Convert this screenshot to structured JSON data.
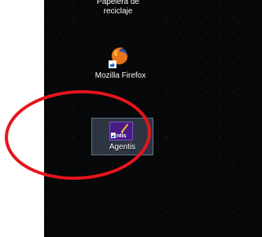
{
  "desktop": {
    "icons": [
      {
        "label_lines": [
          "Papelera de",
          "reciclaje"
        ],
        "icon": "recycle-bin-icon"
      },
      {
        "label": "Mozilla Firefox",
        "icon": "firefox-icon"
      },
      {
        "label": "Agentis",
        "icon": "agentis-icon",
        "selected": true,
        "glyph_text": "ntis"
      }
    ]
  },
  "annotation": {
    "shape": "ellipse",
    "color": "#e8141c"
  },
  "colors": {
    "desktop_background": "#060708",
    "selection": "#788caf"
  }
}
